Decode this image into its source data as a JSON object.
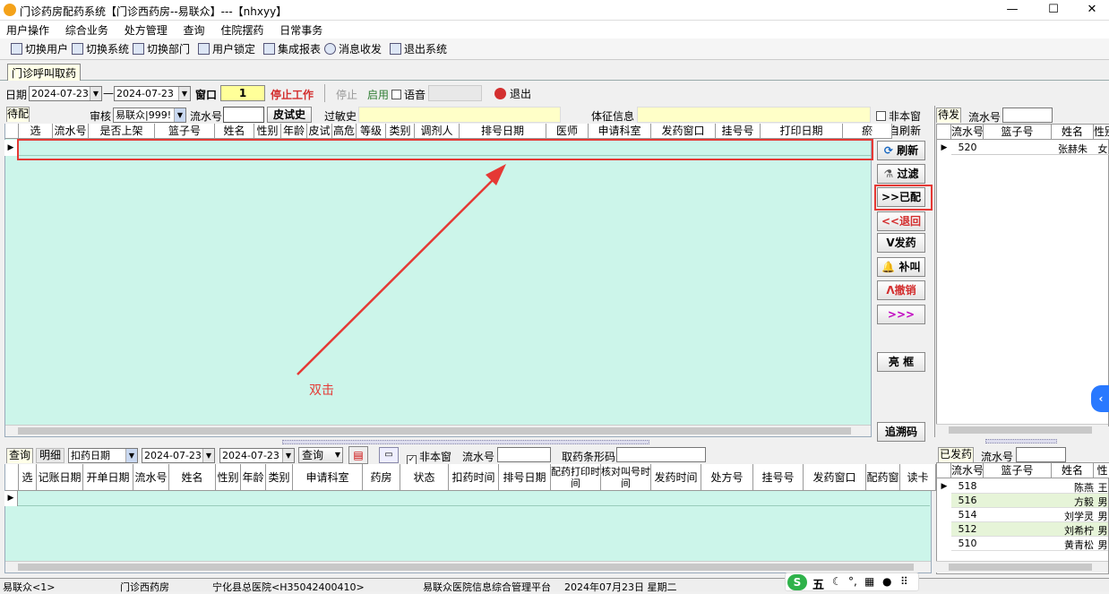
{
  "window": {
    "title": "门诊药房配药系统【门诊西药房--易联众】---【nhxyy】",
    "min": "—",
    "max": "☐",
    "close": "✕"
  },
  "menu": [
    "用户操作",
    "综合业务",
    "处方管理",
    "查询",
    "住院摆药",
    "日常事务"
  ],
  "toolbar": {
    "switch_user": "切换用户",
    "switch_system": "切换系统",
    "switch_dept": "切换部门",
    "lock_user": "用户锁定",
    "report": "集成报表",
    "message": "消息收发",
    "exit_system": "退出系统"
  },
  "tab": "门诊呼叫取药",
  "controls": {
    "date_label": "日期",
    "date_from": "2024-07-23",
    "dash": "—",
    "date_to": "2024-07-23",
    "window_label": "窗口",
    "window_value": "1",
    "stop_work": "停止工作",
    "stop": "停止",
    "enable": "启用",
    "voice": "语音",
    "exit": "退出"
  },
  "row2": {
    "pending": "待配",
    "audit_label": "审核",
    "audit_value": "易联众|999!",
    "flow_label": "流水号",
    "skin_history": "皮试史",
    "allergy_label": "过敏史",
    "physical_label": "体征信息"
  },
  "right_checks": {
    "non_window": "非本窗",
    "auto_refresh": "自刷新"
  },
  "main_headers": [
    "选",
    "流水号",
    "是否上架",
    "篮子号",
    "姓名",
    "性别",
    "年龄",
    "皮试",
    "高危",
    "等级",
    "类别",
    "调剂人",
    "排号日期",
    "医师",
    "申请科室",
    "发药窗口",
    "挂号号",
    "打印日期",
    "瘀"
  ],
  "side_buttons": {
    "refresh": "刷新",
    "filter": "过滤",
    "dispensed": ">>已配",
    "back": "<<退回",
    "send": "V发药",
    "call": "补叫",
    "cancel": "Λ撤销",
    "more": ">>>",
    "bright": "亮  框",
    "trace": "追溯码"
  },
  "annotation": "双击",
  "query_bar": {
    "tab_query": "查询",
    "tab_detail": "明细",
    "mode": "扣药日期",
    "date_from": "2024-07-23",
    "date_to": "2024-07-23",
    "query": "查询",
    "non_window": "非本窗",
    "flow_label": "流水号",
    "barcode_label": "取药条形码"
  },
  "bottom_headers": [
    "选",
    "记账日期",
    "开单日期",
    "流水号",
    "姓名",
    "性别",
    "年龄",
    "类别",
    "申请科室",
    "药房",
    "状态",
    "扣药时间",
    "排号日期",
    "配药打印时间",
    "核对叫号时间",
    "发药时间",
    "处方号",
    "挂号号",
    "发药窗口",
    "配药窗口",
    "读卡"
  ],
  "waiting": {
    "tab": "待发",
    "flow_label": "流水号",
    "headers": [
      "流水号",
      "篮子号",
      "姓名",
      "性别"
    ],
    "rows": [
      {
        "flow": "520",
        "basket": "",
        "name": "张赫朱",
        "sex": "女"
      }
    ]
  },
  "sent": {
    "tab": "已发药",
    "flow_label": "流水号",
    "headers": [
      "流水号",
      "篮子号",
      "姓名",
      "性"
    ],
    "rows": [
      {
        "flow": "518",
        "basket": "",
        "name": "陈燕",
        "sex": "王"
      },
      {
        "flow": "516",
        "basket": "",
        "name": "方毅",
        "sex": "男"
      },
      {
        "flow": "514",
        "basket": "",
        "name": "刘学灵",
        "sex": "男"
      },
      {
        "flow": "512",
        "basket": "",
        "name": "刘希柠",
        "sex": "男"
      },
      {
        "flow": "510",
        "basket": "",
        "name": "黄青松",
        "sex": "男"
      }
    ]
  },
  "status": {
    "user": "易联众<1>",
    "pharmacy": "门诊西药房",
    "hospital": "宁化县总医院<H35042400410>",
    "platform": "易联众医院信息综合管理平台",
    "date": "2024年07月23日 星期二",
    "ime": "五"
  },
  "colors": {
    "grid_bg": "#ccf5ea",
    "highlight": "#e53935",
    "stop_work": "#d32f2f",
    "enable": "#2e7d32",
    "window_bg": "#ffff99"
  }
}
